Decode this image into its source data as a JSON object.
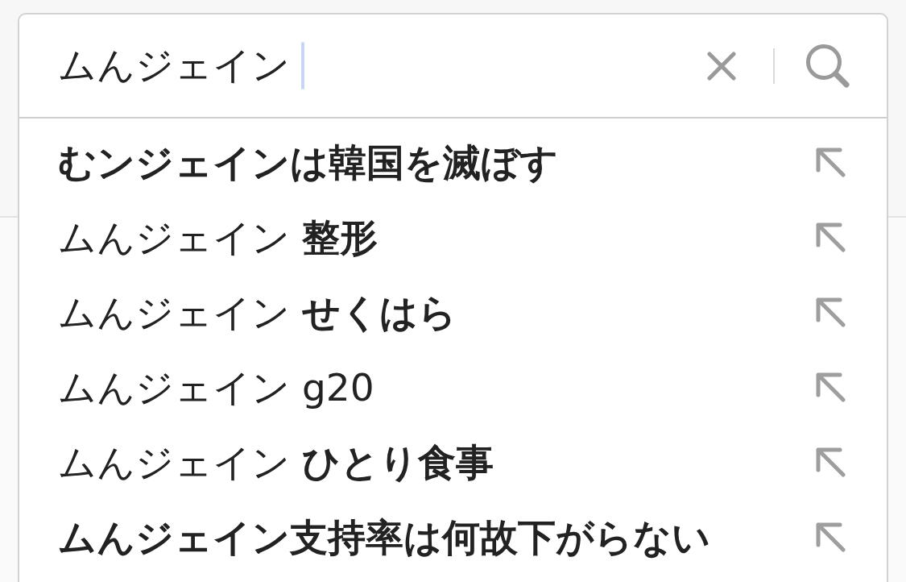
{
  "search": {
    "value": "ムんジェイン",
    "focused": true
  },
  "suggestions": [
    {
      "text": "むンジェインは韓国を滅ぼす",
      "bold": true
    },
    {
      "text": "ムんジェイン **整形**",
      "bold": false
    },
    {
      "text": "ムんジェイン **せくはら**",
      "bold": false
    },
    {
      "text": "ムんジェイン g20",
      "bold": false
    },
    {
      "text": "ムんジェイン **ひとり食事**",
      "bold": false
    },
    {
      "text": "ムんジェイン支持率は何故下がらない",
      "bold": true
    }
  ]
}
